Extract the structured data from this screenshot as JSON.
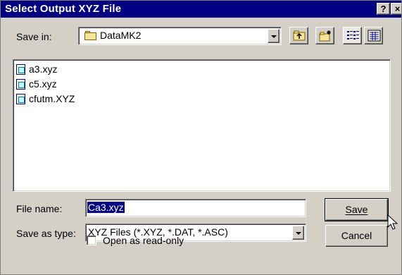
{
  "window": {
    "title": "Select Output XYZ File",
    "help_button": "?",
    "close_button": "×"
  },
  "save_in": {
    "label": "Save in:",
    "value": "DataMK2"
  },
  "files": [
    {
      "name": "a3.xyz"
    },
    {
      "name": "c5.xyz"
    },
    {
      "name": "cfutm.XYZ"
    }
  ],
  "file_name": {
    "label": "File name:",
    "value": "Ca3.xyz"
  },
  "save_as_type": {
    "label": "Save as type:",
    "value": "XYZ Files (*.XYZ, *.DAT, *.ASC)"
  },
  "buttons": {
    "save": "Save",
    "cancel": "Cancel"
  },
  "read_only": {
    "label": "Open as read-only",
    "checked": false
  },
  "colors": {
    "title_bar": "#000080",
    "dialog_face": "#d4d0c8",
    "selection": "#000080"
  }
}
